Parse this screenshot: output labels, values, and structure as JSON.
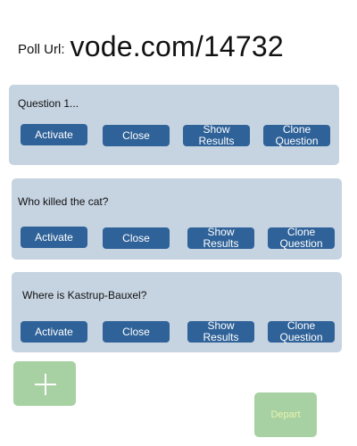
{
  "header": {
    "poll_url_label": "Poll Url:",
    "poll_url_value": "vode.com/14732"
  },
  "questions": [
    {
      "text": "Question 1...",
      "activate_label": "Activate",
      "close_label": "Close",
      "show_results_label": "Show Results",
      "clone_label": "Clone Question"
    },
    {
      "text": "Who killed the cat?",
      "activate_label": "Activate",
      "close_label": "Close",
      "show_results_label": "Show Results",
      "clone_label": "Clone Question"
    },
    {
      "text": "Where is Kastrup-Bauxel?",
      "activate_label": "Activate",
      "close_label": "Close",
      "show_results_label": "Show Results",
      "clone_label": "Clone Question"
    }
  ],
  "footer": {
    "add_icon": "plus-icon",
    "depart_label": "Depart"
  },
  "colors": {
    "card_background": "#c6d3e1",
    "button_primary": "#2f6298",
    "button_success": "#a7d1a2"
  }
}
